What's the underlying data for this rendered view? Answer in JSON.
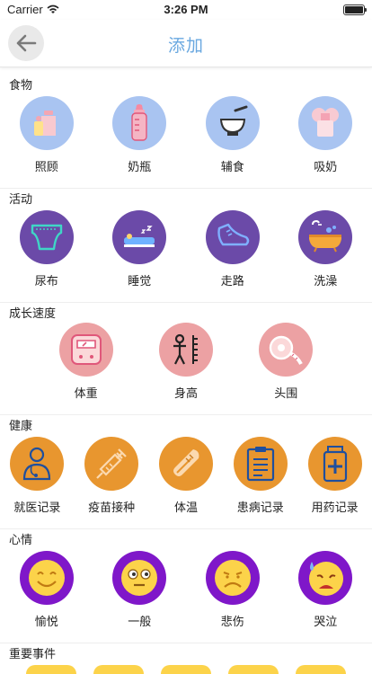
{
  "status": {
    "carrier": "Carrier",
    "time": "3:26 PM"
  },
  "nav": {
    "title": "添加"
  },
  "colors": {
    "food": "#a9c4f1",
    "activity": "#6b4aa8",
    "growth": "#eca1a3",
    "health": "#e8962f",
    "mood": "#7f17c9"
  },
  "sections": [
    {
      "title": "食物",
      "items": [
        {
          "label": "照顾",
          "icon": "bottle-care-icon"
        },
        {
          "label": "奶瓶",
          "icon": "baby-bottle-icon"
        },
        {
          "label": "辅食",
          "icon": "bowl-icon"
        },
        {
          "label": "吸奶",
          "icon": "breast-pump-icon"
        }
      ]
    },
    {
      "title": "活动",
      "items": [
        {
          "label": "尿布",
          "icon": "diaper-icon"
        },
        {
          "label": "睡觉",
          "icon": "sleep-icon"
        },
        {
          "label": "走路",
          "icon": "shoe-icon"
        },
        {
          "label": "洗澡",
          "icon": "bathtub-icon"
        }
      ]
    },
    {
      "title": "成长速度",
      "items": [
        {
          "label": "体重",
          "icon": "scale-icon"
        },
        {
          "label": "身高",
          "icon": "height-icon"
        },
        {
          "label": "头围",
          "icon": "tape-measure-icon"
        }
      ]
    },
    {
      "title": "健康",
      "items": [
        {
          "label": "就医记录",
          "icon": "doctor-icon"
        },
        {
          "label": "疫苗接种",
          "icon": "syringe-icon"
        },
        {
          "label": "体温",
          "icon": "thermometer-icon"
        },
        {
          "label": "患病记录",
          "icon": "clipboard-icon"
        },
        {
          "label": "用药记录",
          "icon": "medicine-icon"
        }
      ]
    },
    {
      "title": "心情",
      "items": [
        {
          "label": "愉悦",
          "icon": "happy-face-icon"
        },
        {
          "label": "一般",
          "icon": "neutral-face-icon"
        },
        {
          "label": "悲伤",
          "icon": "sad-face-icon"
        },
        {
          "label": "哭泣",
          "icon": "crying-face-icon"
        }
      ]
    },
    {
      "title": "重要事件",
      "items": []
    }
  ]
}
